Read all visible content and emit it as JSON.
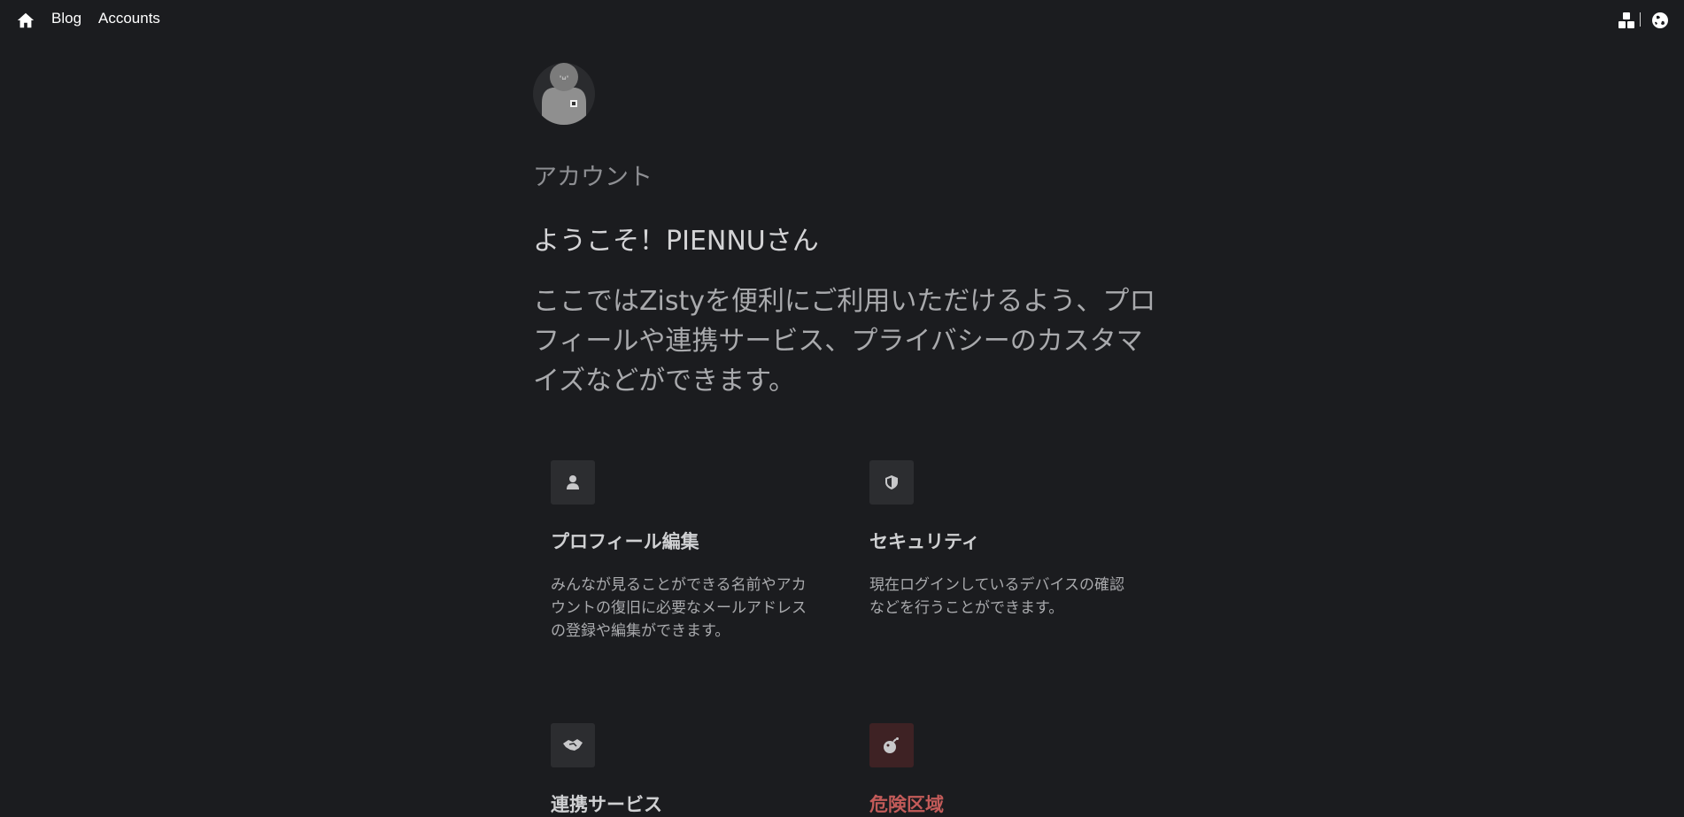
{
  "nav": {
    "home_icon": "home-icon",
    "blog_label": "Blog",
    "accounts_label": "Accounts",
    "apps_icon": "apps-icon",
    "globe_icon": "globe-icon"
  },
  "main": {
    "section_title": "アカウント",
    "welcome": "ようこそ！PIENNUさん",
    "description": "ここではZistyを便利にご利用いただけるよう、プロフィールや連携サービス、プライバシーのカスタマイズなどができます。"
  },
  "cards": [
    {
      "icon": "person-icon",
      "title": "プロフィール編集",
      "description": "みんなが見ることができる名前やアカウントの復旧に必要なメールアドレスの登録や編集ができます。"
    },
    {
      "icon": "shield-icon",
      "title": "セキュリティ",
      "description": "現在ログインしているデバイスの確認などを行うことができます。"
    },
    {
      "icon": "handshake-icon",
      "title": "連携サービス"
    },
    {
      "icon": "bomb-icon",
      "title": "危険区域"
    }
  ],
  "colors": {
    "background": "#1b1c1f",
    "card_icon_bg": "#2c2d30",
    "danger_bg": "#3e2224",
    "danger_text": "#c35b59"
  }
}
